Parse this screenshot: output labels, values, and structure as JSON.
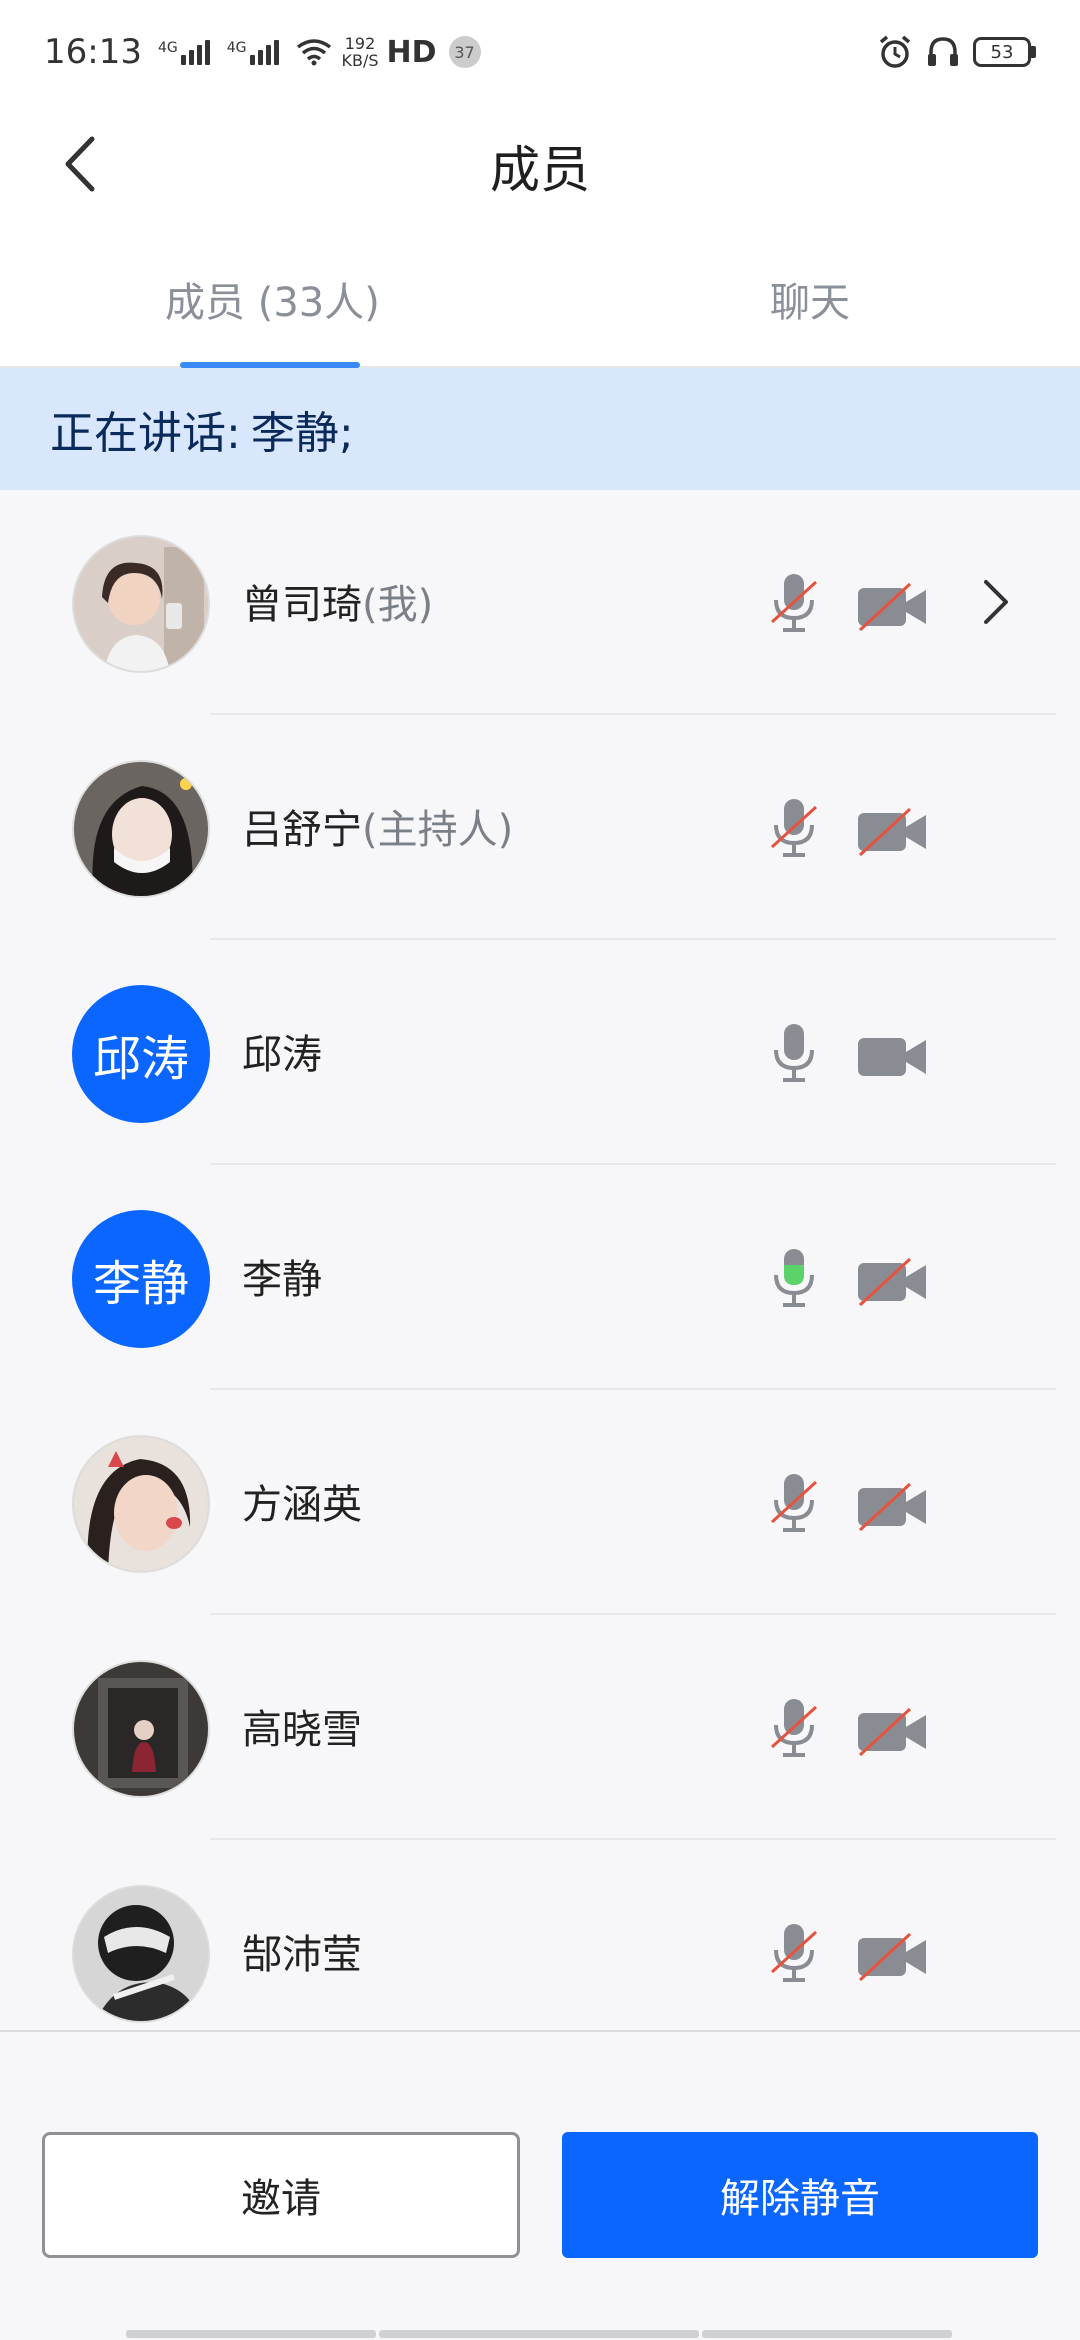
{
  "status_bar": {
    "time": "16:13",
    "net1": "4G",
    "net2": "4G",
    "speed_value": "192",
    "speed_unit": "KB/S",
    "hd": "HD",
    "notification_count": "37",
    "battery": "53"
  },
  "header": {
    "title": "成员"
  },
  "tabs": [
    {
      "label": "成员 (33人)",
      "active": true
    },
    {
      "label": "聊天",
      "active": false
    }
  ],
  "speaking": {
    "label": "正在讲话:",
    "speaker": "李静;"
  },
  "members": [
    {
      "name": "曾司琦",
      "role": "(我)",
      "avatar_type": "photo",
      "mic": "muted",
      "camera": "off",
      "has_arrow": true
    },
    {
      "name": "吕舒宁",
      "role": "(主持人)",
      "avatar_type": "photo",
      "mic": "muted",
      "camera": "off",
      "has_arrow": false
    },
    {
      "name": "邱涛",
      "role": "",
      "avatar_type": "text",
      "avatar_text": "邱涛",
      "mic": "on",
      "camera": "on",
      "has_arrow": false
    },
    {
      "name": "李静",
      "role": "",
      "avatar_type": "text",
      "avatar_text": "李静",
      "mic": "speaking",
      "camera": "off",
      "has_arrow": false
    },
    {
      "name": "方涵英",
      "role": "",
      "avatar_type": "photo",
      "mic": "muted",
      "camera": "off",
      "has_arrow": false
    },
    {
      "name": "高晓雪",
      "role": "",
      "avatar_type": "photo",
      "mic": "muted",
      "camera": "off",
      "has_arrow": false
    },
    {
      "name": "郜沛莹",
      "role": "",
      "avatar_type": "photo",
      "mic": "muted",
      "camera": "off",
      "has_arrow": false
    }
  ],
  "actions": {
    "invite": "邀请",
    "unmute": "解除静音"
  },
  "colors": {
    "accent": "#0b66ff",
    "tab_indicator": "#3a8af5",
    "speaking_banner": "#d8e7fb",
    "speaking_mic": "#5bd36a",
    "muted_slash": "#e5533f"
  }
}
